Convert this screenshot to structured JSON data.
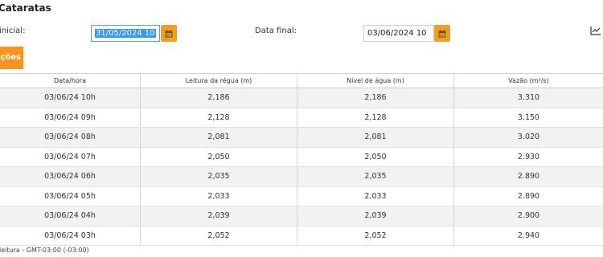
{
  "header": {
    "title": "Cataratas"
  },
  "filters": {
    "start_label": "inicial:",
    "start_value": "31/05/2024 10",
    "end_label": "Data final:",
    "end_value": "03/06/2024 10"
  },
  "action_button_label": "ções",
  "table": {
    "columns": [
      "Data/hora",
      "Leitura da régua (m)",
      "Nível de água (m)",
      "Vazão (m³/s)"
    ],
    "rows": [
      [
        "03/06/24 10h",
        "2,186",
        "2,186",
        "3.310"
      ],
      [
        "03/06/24 09h",
        "2,128",
        "2,128",
        "3.150"
      ],
      [
        "03/06/24 08h",
        "2,081",
        "2,081",
        "3.020"
      ],
      [
        "03/06/24 07h",
        "2,050",
        "2,050",
        "2.930"
      ],
      [
        "03/06/24 06h",
        "2,035",
        "2,035",
        "2.890"
      ],
      [
        "03/06/24 05h",
        "2,033",
        "2,033",
        "2.890"
      ],
      [
        "03/06/24 04h",
        "2,039",
        "2,039",
        "2.900"
      ],
      [
        "03/06/24 03h",
        "2,052",
        "2,052",
        "2.940"
      ]
    ]
  },
  "footer_note": "leitura - GMT-03:00 (-03:00)",
  "icons": {
    "calendar": "calendar-icon",
    "chart": "line-chart-icon"
  },
  "colors": {
    "accent": "#f7941d",
    "selection": "#3399ff",
    "row_alt": "#f2f2f2"
  }
}
